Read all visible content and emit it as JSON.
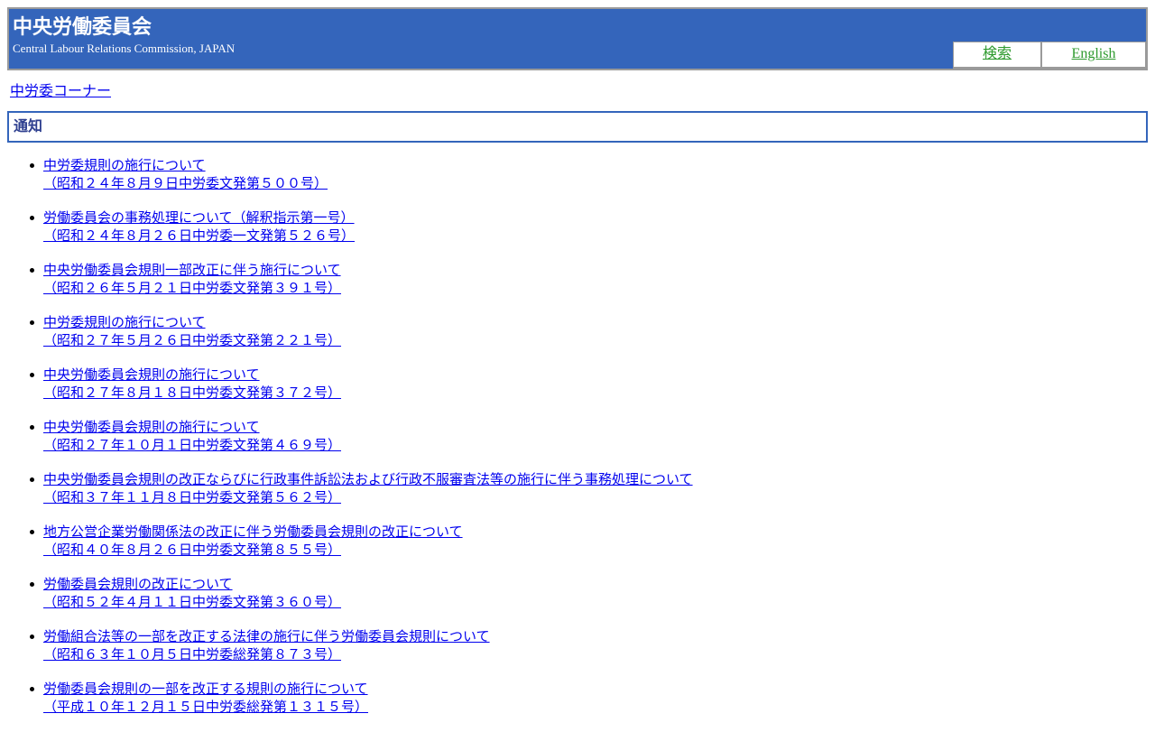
{
  "header": {
    "title": "中央労働委員会",
    "subtitle": "Central Labour Relations Commission, JAPAN",
    "nav": {
      "search": "検索",
      "english": "English"
    }
  },
  "breadcrumb": "中労委コーナー",
  "section": {
    "heading": "通知"
  },
  "notices": [
    {
      "title": "中労委規則の施行について",
      "ref": "（昭和２４年８月９日中労委文発第５００号）"
    },
    {
      "title": "労働委員会の事務処理について（解釈指示第一号）",
      "ref": "（昭和２４年８月２６日中労委一文発第５２６号）"
    },
    {
      "title": "中央労働委員会規則一部改正に伴う施行について",
      "ref": "（昭和２６年５月２１日中労委文発第３９１号）"
    },
    {
      "title": "中労委規則の施行について",
      "ref": "（昭和２７年５月２６日中労委文発第２２１号）"
    },
    {
      "title": "中央労働委員会規則の施行について",
      "ref": "（昭和２７年８月１８日中労委文発第３７２号）"
    },
    {
      "title": "中央労働委員会規則の施行について",
      "ref": "（昭和２７年１０月１日中労委文発第４６９号）"
    },
    {
      "title": "中央労働委員会規則の改正ならびに行政事件訴訟法および行政不服審査法等の施行に伴う事務処理について",
      "ref": "（昭和３７年１１月８日中労委文発第５６２号）"
    },
    {
      "title": "地方公営企業労働関係法の改正に伴う労働委員会規則の改正について",
      "ref": "（昭和４０年８月２６日中労委文発第８５５号）"
    },
    {
      "title": "労働委員会規則の改正について",
      "ref": "（昭和５２年４月１１日中労委文発第３６０号）"
    },
    {
      "title": "労働組合法等の一部を改正する法律の施行に伴う労働委員会規則について",
      "ref": "（昭和６３年１０月５日中労委総発第８７３号）"
    },
    {
      "title": "労働委員会規則の一部を改正する規則の施行について",
      "ref": "（平成１０年１２月１５日中労委総発第１３１５号）"
    }
  ]
}
